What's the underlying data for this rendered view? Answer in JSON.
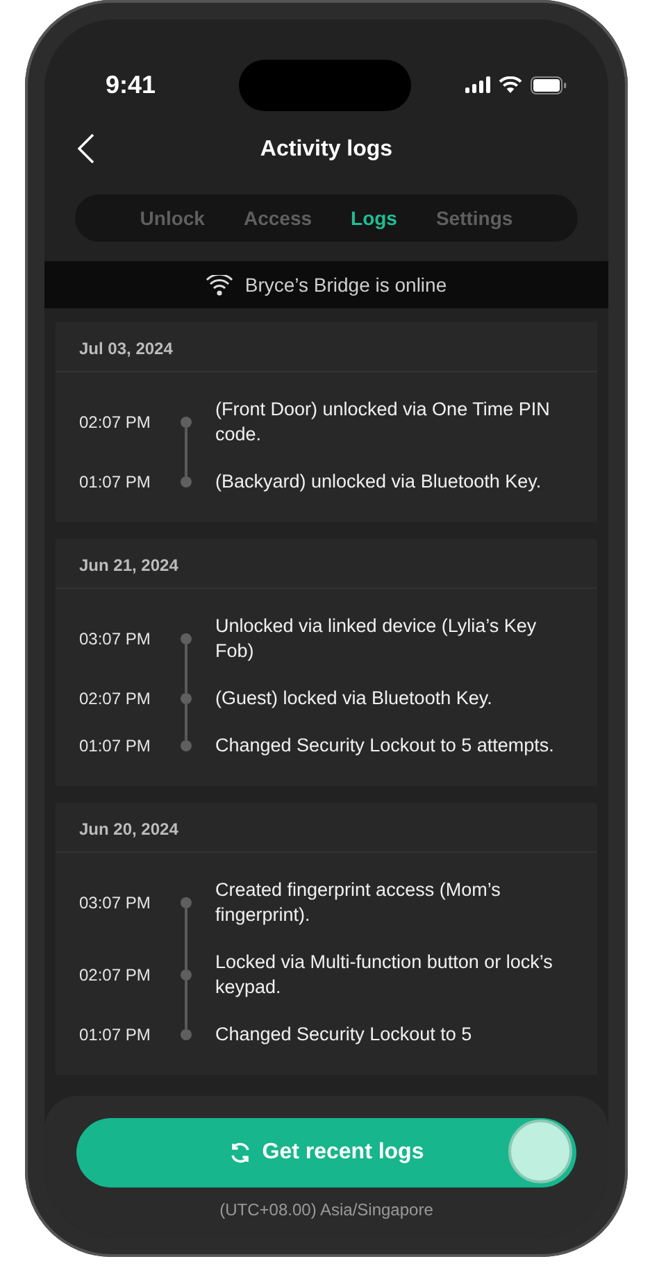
{
  "status_bar": {
    "time": "9:41"
  },
  "header": {
    "title": "Activity logs"
  },
  "tabs": [
    {
      "label": "Unlock",
      "selected": false
    },
    {
      "label": "Access",
      "selected": false
    },
    {
      "label": "Logs",
      "selected": true
    },
    {
      "label": "Settings",
      "selected": false
    }
  ],
  "connection_banner": {
    "text": "Bryce’s Bridge is online"
  },
  "log_groups": [
    {
      "date": "Jul 03, 2024",
      "entries": [
        {
          "time": "02:07 PM",
          "text": "(Front Door) unlocked via One Time PIN code."
        },
        {
          "time": "01:07 PM",
          "text": "(Backyard) unlocked via Bluetooth Key."
        }
      ]
    },
    {
      "date": "Jun 21, 2024",
      "entries": [
        {
          "time": "03:07 PM",
          "text": "Unlocked via linked device (Lylia’s Key Fob)"
        },
        {
          "time": "02:07 PM",
          "text": "(Guest) locked via Bluetooth Key."
        },
        {
          "time": "01:07 PM",
          "text": "Changed Security Lockout to 5 attempts."
        }
      ]
    },
    {
      "date": "Jun 20, 2024",
      "entries": [
        {
          "time": "03:07 PM",
          "text": "Created fingerprint access (Mom’s fingerprint)."
        },
        {
          "time": "02:07 PM",
          "text": "Locked via Multi-function button or lock’s keypad."
        },
        {
          "time": "01:07 PM",
          "text": "Changed Security Lockout to 5"
        }
      ]
    }
  ],
  "action_button": {
    "label": "Get recent logs"
  },
  "timezone": "(UTC+08.00) Asia/Singapore"
}
